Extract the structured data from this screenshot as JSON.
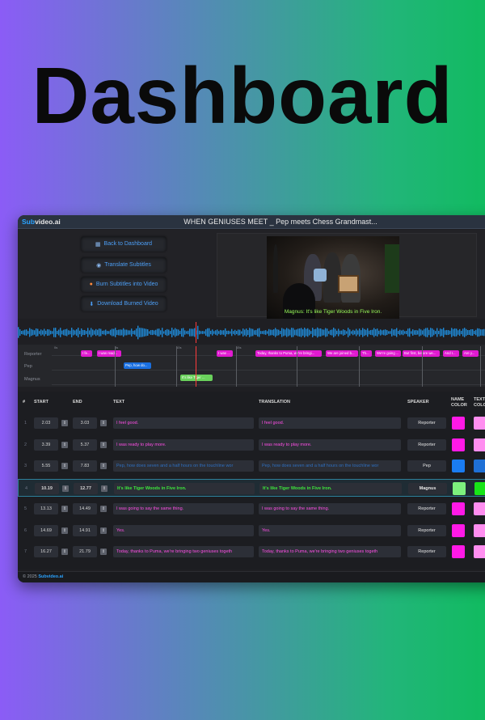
{
  "hero": {
    "title": "Dashboard"
  },
  "app": {
    "brand_a": "Sub",
    "brand_b": "video.ai",
    "video_title": "WHEN GENIUSES MEET _ Pep meets Chess Grandmast..."
  },
  "sidebar": {
    "back": "Back to Dashboard",
    "translate": "Translate Subtitles",
    "burn": "Burn Subtitles into Video",
    "download": "Download Burned Video"
  },
  "video": {
    "caption": "Magnus:  It's like Tiger Woods in Five Iron."
  },
  "timeline": {
    "tracks": [
      "Reporter",
      "Pep",
      "Magnus"
    ],
    "ticks": [
      "0s",
      "5s",
      "10s",
      "15s"
    ],
    "reporter_clips": [
      "I fe...",
      "I was read...",
      "I was ...",
      "Today, thanks to Puma, we're bringi...",
      "We are joined b...",
      "Th...",
      "We're going ...",
      "But first, before we...",
      "And I...",
      "Are y..."
    ],
    "pep_clips": [
      "Pep, how do..."
    ],
    "magnus_clips": [
      "It's like Tiger ..."
    ]
  },
  "table": {
    "headers": {
      "num": "#",
      "start": "START",
      "end": "END",
      "text": "TEXT",
      "translation": "TRANSLATION",
      "speaker": "SPEAKER",
      "name_color": "NAME COLOR",
      "text_color": "TEXT COLO"
    },
    "rows": [
      {
        "num": "1",
        "start": "2.03",
        "end": "3.03",
        "text": "I feel good.",
        "translation": "I feel good.",
        "speaker": "Reporter",
        "name_color": "#ff19e6",
        "text_color": "#ff8ef0",
        "text_fg": "#ff4fe6"
      },
      {
        "num": "2",
        "start": "3.39",
        "end": "5.37",
        "text": "I was ready to play more.",
        "translation": "I was ready to play more.",
        "speaker": "Reporter",
        "name_color": "#ff19e6",
        "text_color": "#ff8ef0",
        "text_fg": "#ff4fe6"
      },
      {
        "num": "3",
        "start": "5.55",
        "end": "7.83",
        "text": "Pep, how does seven and a half hours on the touchline wor",
        "translation": "Pep, how does seven and a half hours on the touchline wor",
        "speaker": "Pep",
        "name_color": "#1a7cf2",
        "text_color": "#1f70d6",
        "text_fg": "#2f6fbf"
      },
      {
        "num": "4",
        "start": "10.19",
        "end": "12.77",
        "text": "It's like Tiger Woods in Five Iron.",
        "translation": "It's like Tiger Woods in Five Iron.",
        "speaker": "Magnus",
        "name_color": "#7df07d",
        "text_color": "#18e418",
        "text_fg": "#3de83d"
      },
      {
        "num": "5",
        "start": "13.13",
        "end": "14.49",
        "text": "I was going to say the same thing.",
        "translation": "I was going to say the same thing.",
        "speaker": "Reporter",
        "name_color": "#ff19e6",
        "text_color": "#ff8ef0",
        "text_fg": "#ff4fe6"
      },
      {
        "num": "6",
        "start": "14.69",
        "end": "14.91",
        "text": "Yes.",
        "translation": "Yes.",
        "speaker": "Reporter",
        "name_color": "#ff19e6",
        "text_color": "#ff8ef0",
        "text_fg": "#ff4fe6"
      },
      {
        "num": "7",
        "start": "16.27",
        "end": "21.79",
        "text": "Today, thanks to Puma, we're bringing two geniuses togeth",
        "translation": "Today, thanks to Puma, we're bringing two geniuses togeth",
        "speaker": "Reporter",
        "name_color": "#ff19e6",
        "text_color": "#ff8ef0",
        "text_fg": "#ff4fe6"
      }
    ],
    "active_row": 3
  },
  "footer": {
    "prefix": "© 2025",
    "brand": "Subvideo.ai"
  }
}
